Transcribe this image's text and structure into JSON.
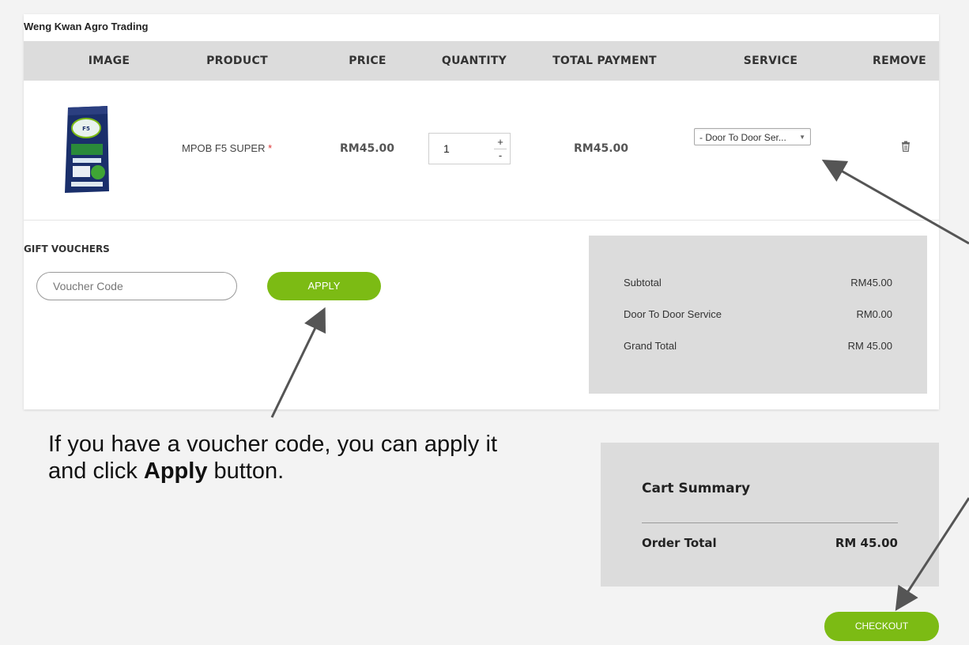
{
  "store": {
    "name": "Weng Kwan Agro Trading"
  },
  "table": {
    "headers": [
      "IMAGE",
      "PRODUCT",
      "PRICE",
      "QUANTITY",
      "TOTAL PAYMENT",
      "SERVICE",
      "REMOVE"
    ],
    "rows": [
      {
        "product_name": "MPOB F5 SUPER",
        "required_mark": "*",
        "price": "RM45.00",
        "quantity": "1",
        "total_payment": "RM45.00",
        "service_selected": "- Door To Door Ser...",
        "image_icon": "fertilizer-bag-icon",
        "remove_icon": "trash-icon"
      }
    ]
  },
  "qty_controls": {
    "plus": "+",
    "minus": "-"
  },
  "vouchers": {
    "label": "GIFT VOUCHERS",
    "placeholder": "Voucher Code",
    "apply_label": "APPLY"
  },
  "totals": {
    "rows": [
      {
        "label": "Subtotal",
        "value": "RM45.00"
      },
      {
        "label": "Door To Door Service",
        "value": "RM0.00"
      },
      {
        "label": "Grand Total",
        "value": "RM 45.00"
      }
    ]
  },
  "annotation": {
    "text_before": "If you have a voucher code, you can apply it and click ",
    "bold": "Apply",
    "text_after": " button."
  },
  "summary": {
    "title": "Cart Summary",
    "order_total_label": "Order Total",
    "order_total_value": "RM 45.00"
  },
  "checkout_label": "CHECKOUT",
  "colors": {
    "accent_green": "#7cbb14",
    "header_gray": "#dcdcdc",
    "page_bg": "#f3f3f3",
    "arrow": "#555555"
  }
}
